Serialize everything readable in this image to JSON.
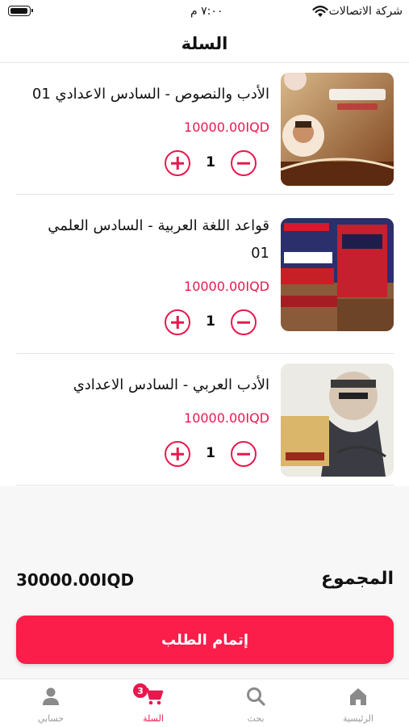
{
  "status_bar": {
    "carrier": "شركة الاتصالات",
    "time": "٧:٠٠ م"
  },
  "header": {
    "title": "السلة"
  },
  "cart": {
    "items": [
      {
        "title": "الأدب والنصوص - السادس الاعدادي 01",
        "price": "10000.00IQD",
        "quantity": "1",
        "image_icon": "book-cover-adab-nusus"
      },
      {
        "title": "قواعد اللغة العربية - السادس العلمي 01",
        "price": "10000.00IQD",
        "quantity": "1",
        "image_icon": "book-cover-qawaid"
      },
      {
        "title": "الأدب العربي - السادس الاعدادي",
        "price": "10000.00IQD",
        "quantity": "1",
        "image_icon": "book-cover-adab-arabi"
      }
    ]
  },
  "summary": {
    "total_label": "المجموع",
    "total_value": "30000.00IQD"
  },
  "checkout": {
    "label": "إتمام الطلب"
  },
  "tab_bar": {
    "tabs": [
      {
        "label": "الرئيسية",
        "icon": "home-icon"
      },
      {
        "label": "بحث",
        "icon": "search-icon"
      },
      {
        "label": "السلة",
        "icon": "cart-icon",
        "badge": "3"
      },
      {
        "label": "حسابي",
        "icon": "user-icon"
      }
    ]
  },
  "colors": {
    "accent": "#e8184e",
    "button": "#fb1d4a"
  }
}
